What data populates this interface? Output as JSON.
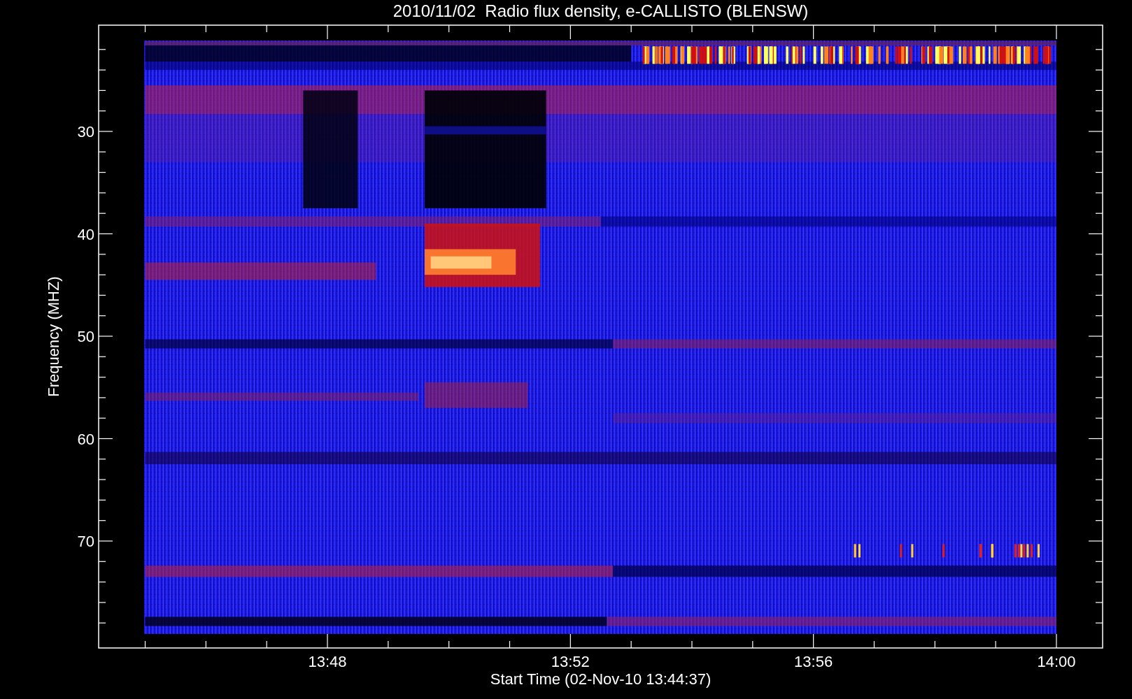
{
  "title": "2010/11/02  Radio flux density, e-CALLISTO (BLENSW)",
  "chart": {
    "ylabel": "Frequency (MHZ)",
    "xlabel": "Start Time (02-Nov-10 13:44:37)",
    "yticks": [
      "30",
      "40",
      "50",
      "60",
      "70"
    ],
    "xticks": [
      "13:48",
      "13:52",
      "13:56",
      "14:00"
    ]
  }
}
